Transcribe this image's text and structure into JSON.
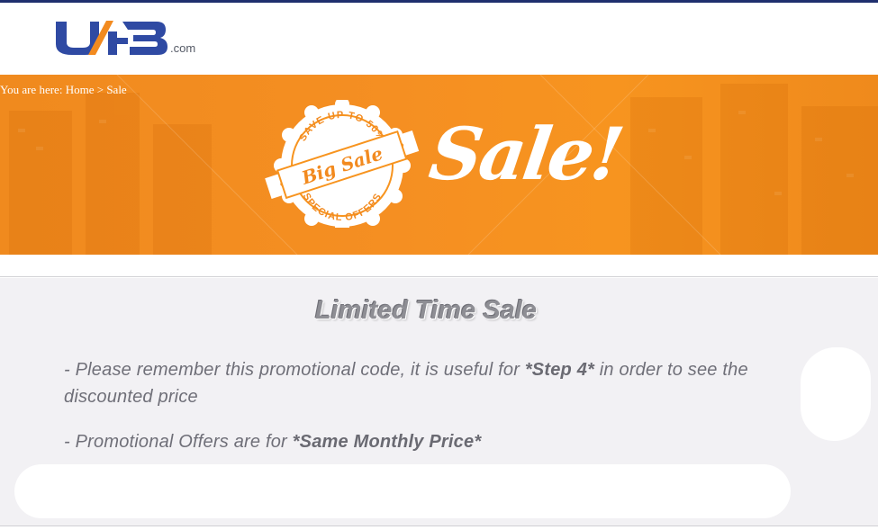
{
  "header": {
    "logo_text": "UFB",
    "logo_tld": ".com",
    "brand_color": "#2f4aa3"
  },
  "banner": {
    "breadcrumb_prefix": "You are here:",
    "breadcrumb_home": "Home",
    "breadcrumb_separator": ">",
    "breadcrumb_current": "Sale",
    "badge_top_text": "SAVE UP TO 50%",
    "badge_ribbon_text": "Big Sale",
    "badge_bottom_text": "SPECIAL OFFERS",
    "headline": "Sale!",
    "background_color": "#f7941f"
  },
  "main": {
    "title": "Limited Time Sale",
    "note1_text": "- Please remember this promotional code, it is useful for ",
    "note1_emphasis": "*Step 4*",
    "note1_tail": " in order to see the discounted price",
    "note2_text": "- Promotional Offers are for ",
    "note2_emphasis": "*Same Monthly Price*"
  }
}
